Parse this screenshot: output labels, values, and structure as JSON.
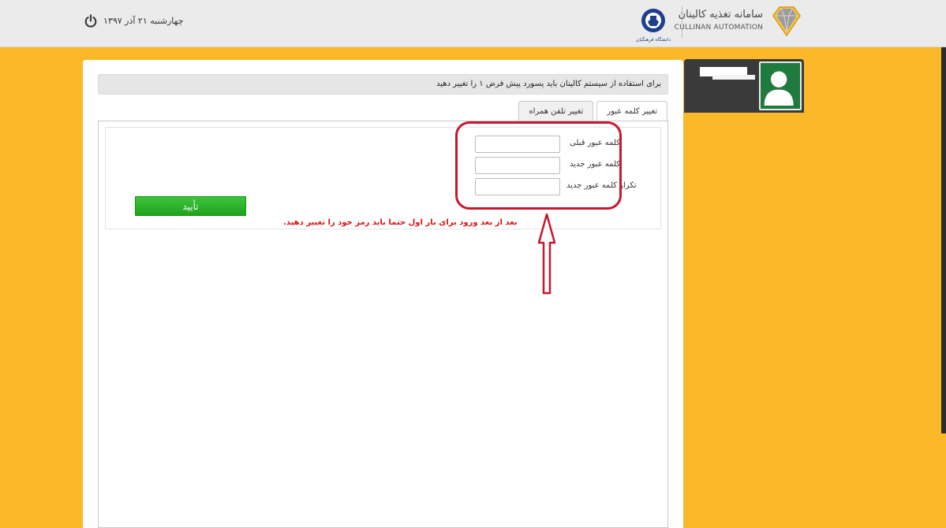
{
  "header": {
    "date": "چهارشنبه ۲۱ آذر ۱۳۹۷",
    "brand_title": "سامانه تغذیه کالینان",
    "brand_subtitle": "CULLINAN AUTOMATION",
    "logo_caption": "دانشگاه فرهنگیان"
  },
  "notice": "برای استفاده از سیستم کالینان باید پسورد پیش فرض ۱ را تغییر دهید",
  "tabs": [
    {
      "label": "تغییر کلمه عبور",
      "active": true
    },
    {
      "label": "تغییر تلفن همراه",
      "active": false
    }
  ],
  "form": {
    "old_password_label": "کلمه عبور قبلی",
    "new_password_label": "کلمه عبور جدید",
    "repeat_password_label": "تکرار کلمه عبور جدید",
    "old_password_value": "",
    "new_password_value": "",
    "repeat_password_value": "",
    "confirm_label": "تأیید"
  },
  "annotation": "بعد از بعد ورود برای بار اول حتما باید رمز خود را تغییر دهید.",
  "colors": {
    "background": "#fbb92a",
    "header": "#ebebeb",
    "confirm_button": "#2fb52d",
    "annotation": "#d41818",
    "user_card": "#3a3a3a",
    "avatar": "#1f7a3d"
  },
  "icons": {
    "power": "power-icon",
    "avatar": "user-icon",
    "diamond": "diamond-icon",
    "university": "university-logo-icon",
    "arrow": "up-arrow-icon"
  }
}
